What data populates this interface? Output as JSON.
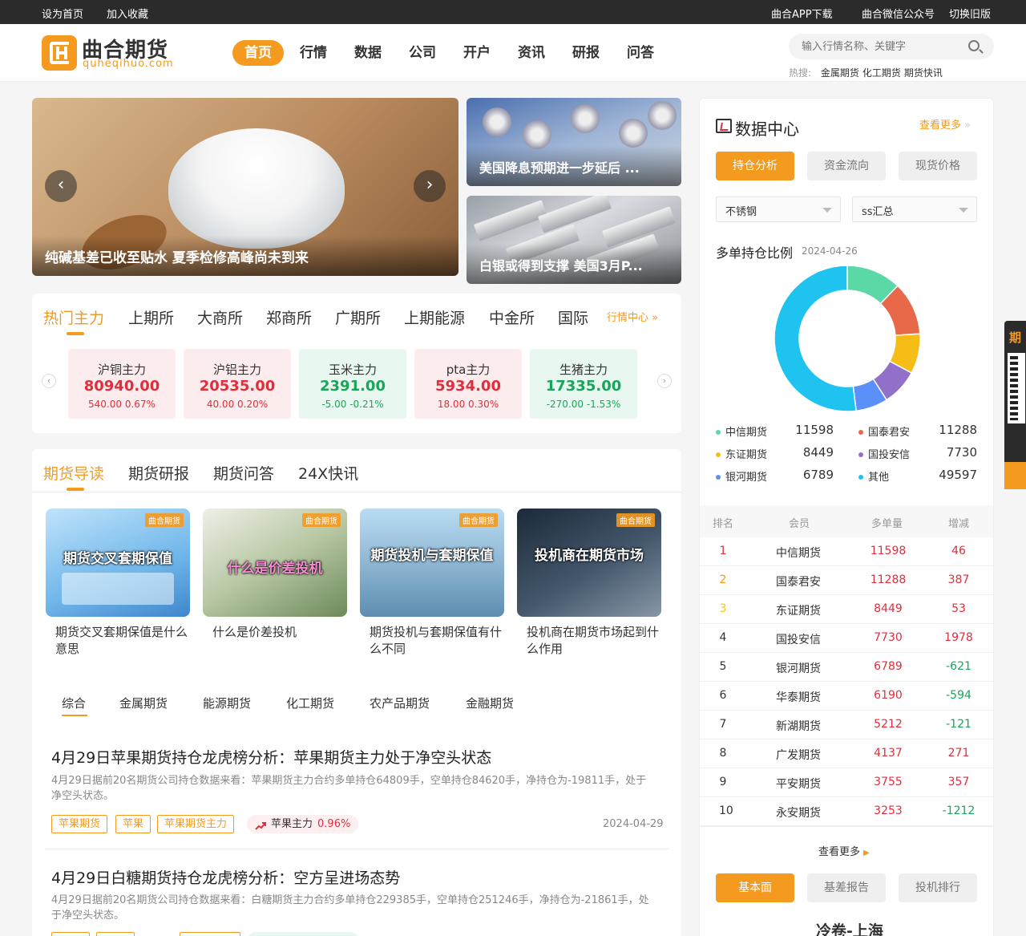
{
  "topbar": {
    "left": [
      "设为首页",
      "加入收藏"
    ],
    "right": [
      "曲合APP下载",
      "曲合微信公众号",
      "切换旧版"
    ]
  },
  "logo": {
    "name": "曲合期货",
    "sub": "quheqihuo.com"
  },
  "nav": [
    "首页",
    "行情",
    "数据",
    "公司",
    "开户",
    "资讯",
    "研报",
    "问答"
  ],
  "search": {
    "placeholder": "输入行情名称、关键字",
    "hot_label": "热搜:",
    "hot_items": [
      "金属期货",
      "化工期货",
      "期货快讯"
    ]
  },
  "banner": {
    "main_caption": "纯碱基差已收至贴水 夏季检修高峰尚未到来",
    "side": [
      "美国降息预期进一步延后 ...",
      "白银或得到支撑 美国3月P..."
    ],
    "prev_icon": "‹",
    "next_icon": "›"
  },
  "market": {
    "tabs": [
      "热门主力",
      "上期所",
      "大商所",
      "郑商所",
      "广期所",
      "上期能源",
      "中金所",
      "国际"
    ],
    "more": "行情中心",
    "quotes": [
      {
        "name": "沪铜主力",
        "price": "80940.00",
        "change": "540.00 0.67%",
        "dir": "up"
      },
      {
        "name": "沪铝主力",
        "price": "20535.00",
        "change": "40.00 0.20%",
        "dir": "up"
      },
      {
        "name": "玉米主力",
        "price": "2391.00",
        "change": "-5.00 -0.21%",
        "dir": "down"
      },
      {
        "name": "pta主力",
        "price": "5934.00",
        "change": "18.00 0.30%",
        "dir": "up"
      },
      {
        "name": "生猪主力",
        "price": "17335.00",
        "change": "-270.00 -1.53%",
        "dir": "down"
      }
    ]
  },
  "guide": {
    "tabs": [
      "期货导读",
      "期货研报",
      "期货问答",
      "24X快讯"
    ],
    "cards": [
      {
        "title": "期货交叉套期保值是什么意思",
        "image_text": "期货交叉套期保值"
      },
      {
        "title": "什么是价差投机",
        "image_text": "什么是价差投机"
      },
      {
        "title": "期货投机与套期保值有什么不同",
        "image_text": "期货投机与套期保值"
      },
      {
        "title": "投机商在期货市场起到什么作用",
        "image_text": "投机商在期货市场"
      }
    ],
    "thumb_logo": "曲合期货",
    "subtabs": [
      "综合",
      "金属期货",
      "能源期货",
      "化工期货",
      "农产品期货",
      "金融期货"
    ],
    "articles": [
      {
        "title": "4月29日苹果期货持仓龙虎榜分析：苹果期货主力处于净空头状态",
        "desc": "4月29日据前20名期货公司持仓数据来看：苹果期货主力合约多单持仓64809手，空单持仓84620手，净持仓为-19811手，处于净空头状态。",
        "tags": [
          "苹果期货",
          "苹果",
          "苹果期货主力"
        ],
        "hot": {
          "name": "苹果主力",
          "value": "0.96%"
        },
        "date": "2024-04-29"
      },
      {
        "title": "4月29日白糖期货持仓龙虎榜分析：空方呈进场态势",
        "desc": "4月29日据前20名期货公司持仓数据来看：白糖期货主力合约多单持仓229385手，空单持仓251246手，净持仓为-21861手，处于净空头状态。"
      }
    ]
  },
  "data_center": {
    "title": "数据中心",
    "more": "查看更多",
    "buttons": [
      "持仓分析",
      "资金流向",
      "现货价格"
    ],
    "select1": "不锈钢",
    "select2": "ss汇总",
    "chart_title": "多单持仓比例",
    "chart_date": "2024-04-26",
    "rank_headers": [
      "排名",
      "会员",
      "多单量",
      "增减"
    ],
    "ranks": [
      {
        "rank": "1",
        "name": "中信期货",
        "vol": "11598",
        "chg": "46"
      },
      {
        "rank": "2",
        "name": "国泰君安",
        "vol": "11288",
        "chg": "387"
      },
      {
        "rank": "3",
        "name": "东证期货",
        "vol": "8449",
        "chg": "53"
      },
      {
        "rank": "4",
        "name": "国投安信",
        "vol": "7730",
        "chg": "1978"
      },
      {
        "rank": "5",
        "name": "银河期货",
        "vol": "6789",
        "chg": "-621"
      },
      {
        "rank": "6",
        "name": "华泰期货",
        "vol": "6190",
        "chg": "-594"
      },
      {
        "rank": "7",
        "name": "新湖期货",
        "vol": "5212",
        "chg": "-121"
      },
      {
        "rank": "8",
        "name": "广发期货",
        "vol": "4137",
        "chg": "271"
      },
      {
        "rank": "9",
        "name": "平安期货",
        "vol": "3755",
        "chg": "357"
      },
      {
        "rank": "10",
        "name": "永安期货",
        "vol": "3253",
        "chg": "-1212"
      }
    ],
    "view_more": "查看更多",
    "bottom_buttons": [
      "基本面",
      "基差报告",
      "投机排行"
    ],
    "bottom_title": "冷卷-上海"
  },
  "side_float": {
    "label": "期"
  },
  "chart_data": {
    "type": "pie",
    "title": "多单持仓比例",
    "subtitle": "2024-04-26",
    "categories": [
      "中信期货",
      "国泰君安",
      "东证期货",
      "国投安信",
      "银河期货",
      "其他"
    ],
    "values": [
      11598,
      11288,
      8449,
      7730,
      6789,
      49597
    ],
    "colors": [
      "#5ad8a6",
      "#e8684a",
      "#f6bd16",
      "#9270ca",
      "#5b8ff9",
      "#1fc3ef"
    ],
    "legend": "bottom",
    "donut": true
  }
}
